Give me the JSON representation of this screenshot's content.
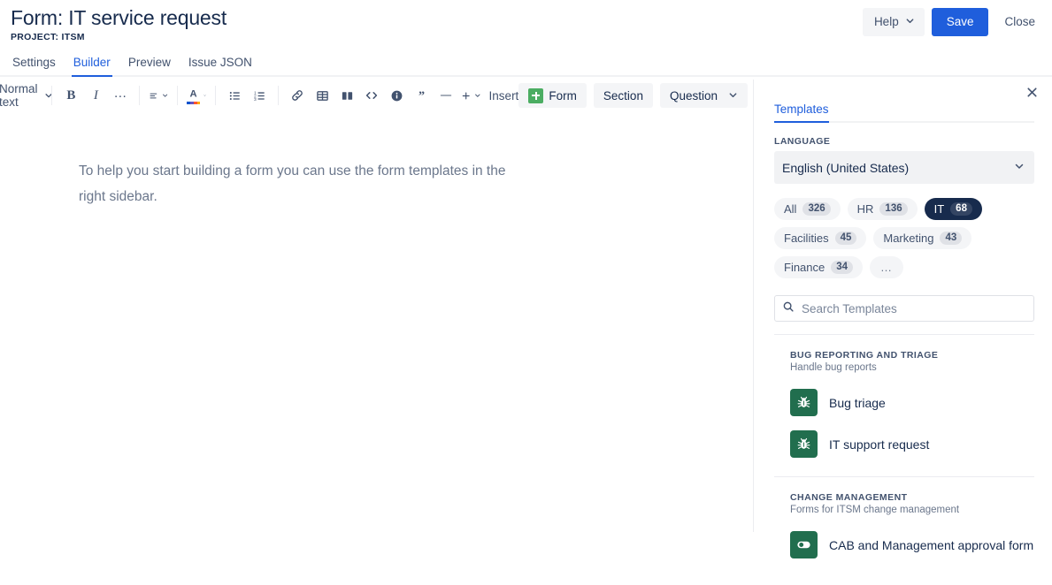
{
  "header": {
    "title": "Form: IT service request",
    "project": "PROJECT: ITSM",
    "help_label": "Help",
    "help_chevron": "chevron-down-icon",
    "save_label": "Save",
    "close_label": "Close",
    "primary_color": "#1F5EDC"
  },
  "nav": {
    "tabs": [
      {
        "label": "Settings",
        "active": false
      },
      {
        "label": "Builder",
        "active": true
      },
      {
        "label": "Preview",
        "active": false
      },
      {
        "label": "Issue JSON",
        "active": false
      }
    ]
  },
  "toolbar": {
    "text_style": "Normal text",
    "bold": "B",
    "italic": "I",
    "more_formatting": "…",
    "insert_label": "Insert",
    "form_label": "Form",
    "section_label": "Section",
    "question_label": "Question",
    "icons": [
      "text-style-dropdown",
      "bold-icon",
      "italic-icon",
      "more-formatting-icon",
      "text-align-icon",
      "text-color-icon",
      "bullet-list-icon",
      "numbered-list-icon",
      "link-icon",
      "table-icon",
      "layout-icon",
      "code-icon",
      "info-panel-icon",
      "quote-icon",
      "divider-icon",
      "insert-more-icon"
    ]
  },
  "editor": {
    "paragraph": "To help you start building a form you can use the form templates in the right sidebar."
  },
  "sidebar": {
    "close_icon": "close-icon",
    "tab_label": "Templates",
    "language_label": "LANGUAGE",
    "language_value": "English (United States)",
    "chips": [
      {
        "label": "All",
        "count": "326",
        "selected": false
      },
      {
        "label": "HR",
        "count": "136",
        "selected": false
      },
      {
        "label": "IT",
        "count": "68",
        "selected": true
      },
      {
        "label": "Facilities",
        "count": "45",
        "selected": false
      },
      {
        "label": "Marketing",
        "count": "43",
        "selected": false
      },
      {
        "label": "Finance",
        "count": "34",
        "selected": false
      }
    ],
    "more_chip": "…",
    "search_placeholder": "Search Templates",
    "search_value": "",
    "search_icon": "search-icon",
    "groups": [
      {
        "title": "BUG REPORTING AND TRIAGE",
        "desc": "Handle bug reports",
        "items": [
          {
            "name": "Bug triage",
            "icon": "bug-icon"
          },
          {
            "name": "IT support request",
            "icon": "bug-icon"
          }
        ]
      },
      {
        "title": "CHANGE MANAGEMENT",
        "desc": "Forms for ITSM change management",
        "items": [
          {
            "name": "CAB and Management approval form",
            "icon": "toggle-icon"
          }
        ]
      }
    ]
  }
}
